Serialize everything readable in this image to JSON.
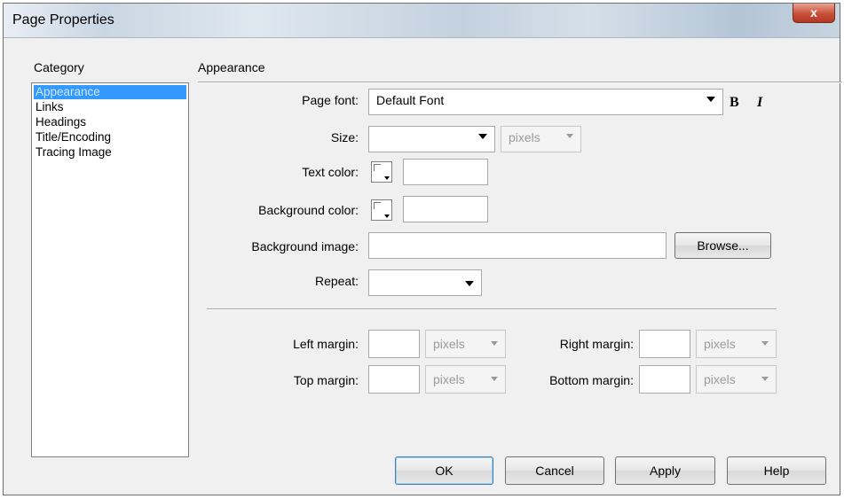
{
  "window": {
    "title": "Page Properties",
    "close_symbol": "x"
  },
  "category": {
    "label": "Category",
    "items": [
      "Appearance",
      "Links",
      "Headings",
      "Title/Encoding",
      "Tracing Image"
    ],
    "selected": "Appearance"
  },
  "section": {
    "title": "Appearance"
  },
  "form": {
    "page_font_label": "Page font:",
    "page_font_value": "Default Font",
    "bold_label": "B",
    "italic_label": "I",
    "size_label": "Size:",
    "size_value": "",
    "size_unit": "pixels",
    "text_color_label": "Text color:",
    "text_color_value": "",
    "bg_color_label": "Background color:",
    "bg_color_value": "",
    "bg_image_label": "Background image:",
    "bg_image_value": "",
    "browse_label": "Browse...",
    "repeat_label": "Repeat:",
    "repeat_value": ""
  },
  "margins": {
    "left_label": "Left margin:",
    "left_value": "",
    "left_unit": "pixels",
    "right_label": "Right margin:",
    "right_value": "",
    "right_unit": "pixels",
    "top_label": "Top margin:",
    "top_value": "",
    "top_unit": "pixels",
    "bottom_label": "Bottom margin:",
    "bottom_value": "",
    "bottom_unit": "pixels"
  },
  "buttons": {
    "ok": "OK",
    "cancel": "Cancel",
    "apply": "Apply",
    "help": "Help"
  },
  "colors": {
    "selection": "#3399ff",
    "close": "#c8503a"
  }
}
